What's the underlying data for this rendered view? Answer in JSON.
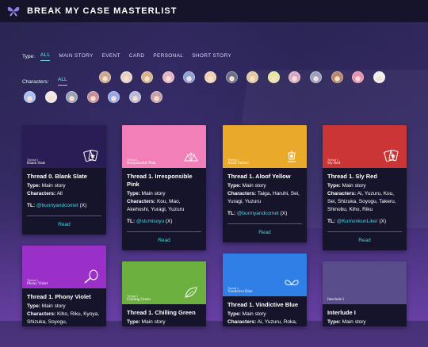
{
  "header": {
    "title": "BREAK MY CASE MASTERLIST"
  },
  "filters": {
    "type_label": "Type:",
    "types": [
      "ALL",
      "MAIN STORY",
      "EVENT",
      "CARD",
      "PERSONAL",
      "SHORT STORY"
    ],
    "characters_label": "Characters:",
    "characters_all": "ALL",
    "avatar_colors": [
      "#c9a88e",
      "#e8d0c8",
      "#d7b48a",
      "#e6b2c4",
      "#8ea0d8",
      "#f0d0b0",
      "#6a7088",
      "#e3c9a0",
      "#e6e6a0",
      "#d8a8c8",
      "#9aa0c0",
      "#b8866a",
      "#e890b0",
      "#f0f0f0",
      "#a8c0f0",
      "#f4e6e6",
      "#9aa2b8",
      "#c89098",
      "#94a8e8",
      "#b8b8d8",
      "#c8a0a8"
    ]
  },
  "labels": {
    "type": "Type:",
    "characters": "Characters:",
    "tl": "TL:",
    "read": "Read"
  },
  "cards": [
    {
      "tag": "Thread 0",
      "name": "Blank Slate",
      "title": "Thread 0. Blank Slate",
      "type": "Main story",
      "characters": "All",
      "tl_user": "@bunnyandcomet",
      "tl_note": "(X)",
      "color": "#2a1c55",
      "emblem": "cards-icon"
    },
    {
      "tag": "Thread 1",
      "name": "Irresponsible Pink",
      "title": "Thread 1. Irresponsible Pink",
      "type": "Main story",
      "characters": "Kou, Mao, Akehoshi, Yuragi, Yuzuru",
      "tl_user": "@slcmisoyu",
      "tl_note": "(X)",
      "color": "#f27fb8",
      "emblem": "fan-icon"
    },
    {
      "tag": "Thread 1",
      "name": "Aloof Yellow",
      "title": "Thread 1. Aloof Yellow",
      "type": "Main story",
      "characters": "Taiga, Haruhi, Sei, Yuragi, Yuzuru",
      "tl_user": "@bunnyandcomet",
      "tl_note": "(X)",
      "color": "#e9aa2c",
      "emblem": "lamp-icon"
    },
    {
      "tag": "Thread 1",
      "name": "Sly Red",
      "title": "Thread 1. Sly Red",
      "type": "Main story",
      "characters": "Ai, Yuzuru, Kou, Sei, Shizuka, Soyogu, Takeru, Shinobu, Kiho, Riku",
      "tl_user": "@KumonkunLiker",
      "tl_note": "(X)",
      "color": "#cc3535",
      "emblem": "cards-icon"
    },
    {
      "tag": "Thread 1",
      "name": "Phony Violet",
      "title": "Thread 1. Phony Violet",
      "type": "Main story",
      "characters": "Kiho, Riku, Kyoya, Shizuka, Soyogu,",
      "color": "#9a30c8",
      "emblem": "mirror-icon"
    },
    {
      "tag": "Thread 1",
      "name": "Chilling Green",
      "title": "Thread 1. Chilling Green",
      "type": "Main story",
      "color": "#6cb040",
      "emblem": "leaf-icon"
    },
    {
      "tag": "Thread 1",
      "name": "Vindictive Blue",
      "title": "Thread 1. Vindictive Blue",
      "type": "Main story",
      "characters": "Ai, Yuzuru, Roka,",
      "color": "#2f7fe6",
      "emblem": "butterfly-icon"
    },
    {
      "tag": "",
      "name": "Interlude I",
      "title": "Interlude I",
      "type": "Main story",
      "color": "#584c8a",
      "emblem": ""
    }
  ]
}
